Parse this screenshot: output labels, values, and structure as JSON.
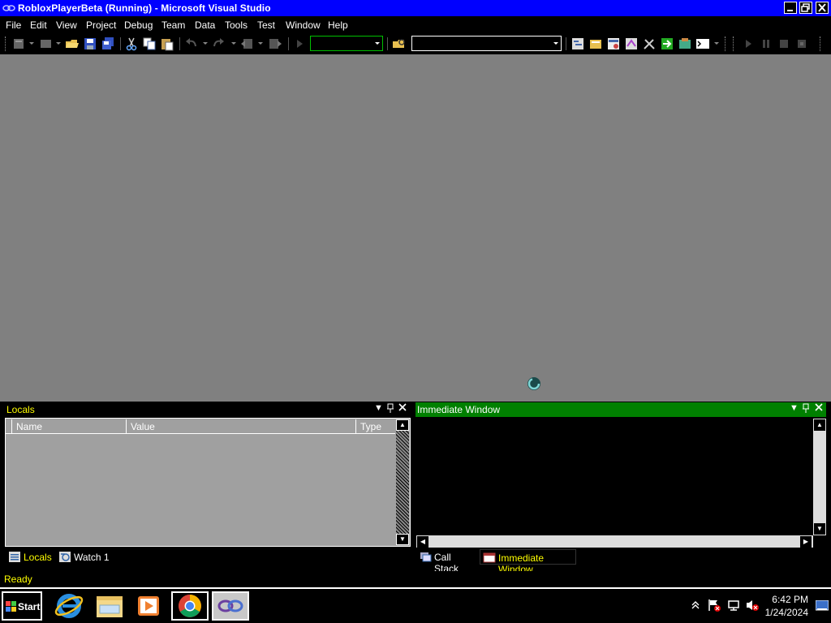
{
  "window": {
    "title": "RobloxPlayerBeta (Running) - Microsoft Visual Studio"
  },
  "menu": [
    "File",
    "Edit",
    "View",
    "Project",
    "Debug",
    "Team",
    "Data",
    "Tools",
    "Test",
    "Window",
    "Help"
  ],
  "toolbar": {
    "config_combo_value": "",
    "find_combo_value": ""
  },
  "locals_panel": {
    "title": "Locals",
    "columns": [
      "Name",
      "Value",
      "Type"
    ]
  },
  "immediate_panel": {
    "title": "Immediate Window"
  },
  "bottom_tabs_left": [
    {
      "label": "Locals",
      "icon": "locals-icon",
      "active": true
    },
    {
      "label": "Watch 1",
      "icon": "watch-icon",
      "active": false
    }
  ],
  "bottom_tabs_right": [
    {
      "label": "Call Stack",
      "icon": "call-stack-icon",
      "active": false
    },
    {
      "label": "Immediate Window",
      "icon": "immediate-window-icon",
      "active": true
    }
  ],
  "status": {
    "text": "Ready"
  },
  "taskbar": {
    "start_label": "Start",
    "apps": [
      "internet-explorer-icon",
      "file-explorer-icon",
      "media-player-icon",
      "chrome-icon",
      "visual-studio-icon"
    ],
    "time": "6:42 PM",
    "date": "1/24/2024"
  },
  "colors": {
    "titlebar": "#0000ff",
    "workspace": "#808080",
    "immediate_header": "#008000",
    "status_text": "#ffff00",
    "locals_header_text": "#ffff00"
  }
}
